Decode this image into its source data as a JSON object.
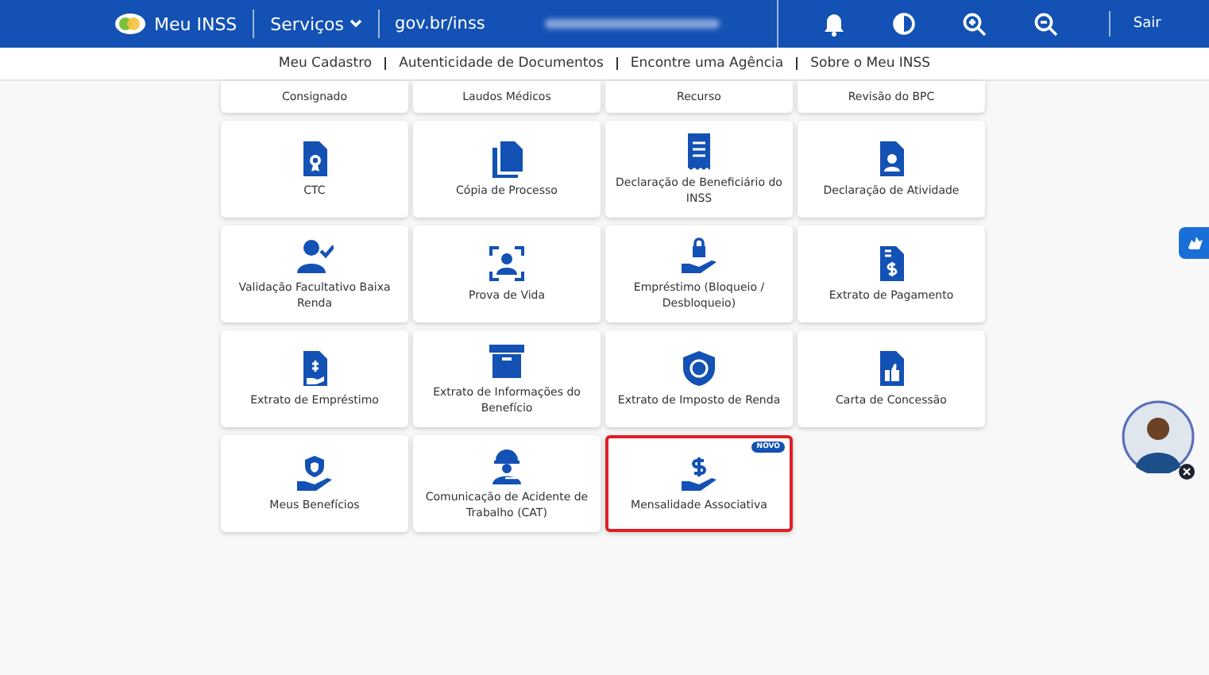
{
  "header": {
    "brand": "Meu INSS",
    "menu": "Serviços",
    "site": "gov.br/inss",
    "logout": "Sair"
  },
  "nav": [
    "Meu Cadastro",
    "Autenticidade de Documentos",
    "Encontre uma Agência",
    "Sobre o Meu INSS"
  ],
  "partial_cards": [
    "Consignado",
    "Laudos Médicos",
    "Recurso",
    "Revisão do BPC"
  ],
  "cards": [
    {
      "label": "CTC",
      "highlighted": false
    },
    {
      "label": "Cópia de Processo",
      "highlighted": false
    },
    {
      "label": "Declaração de Beneficiário do INSS",
      "highlighted": false
    },
    {
      "label": "Declaração de Atividade",
      "highlighted": false
    },
    {
      "label": "Validação Facultativo Baixa Renda",
      "highlighted": false
    },
    {
      "label": "Prova de Vida",
      "highlighted": false
    },
    {
      "label": "Empréstimo (Bloqueio / Desbloqueio)",
      "highlighted": false
    },
    {
      "label": "Extrato de Pagamento",
      "highlighted": false
    },
    {
      "label": "Extrato de Empréstimo",
      "highlighted": false
    },
    {
      "label": "Extrato de Informações do Benefício",
      "highlighted": false
    },
    {
      "label": "Extrato de Imposto de Renda",
      "highlighted": false
    },
    {
      "label": "Carta de Concessão",
      "highlighted": false
    },
    {
      "label": "Meus Benefícios",
      "highlighted": false
    },
    {
      "label": "Comunicação de Acidente de Trabalho (CAT)",
      "highlighted": false
    },
    {
      "label": "Mensalidade Associativa",
      "highlighted": true,
      "badge": "NOVO"
    }
  ]
}
